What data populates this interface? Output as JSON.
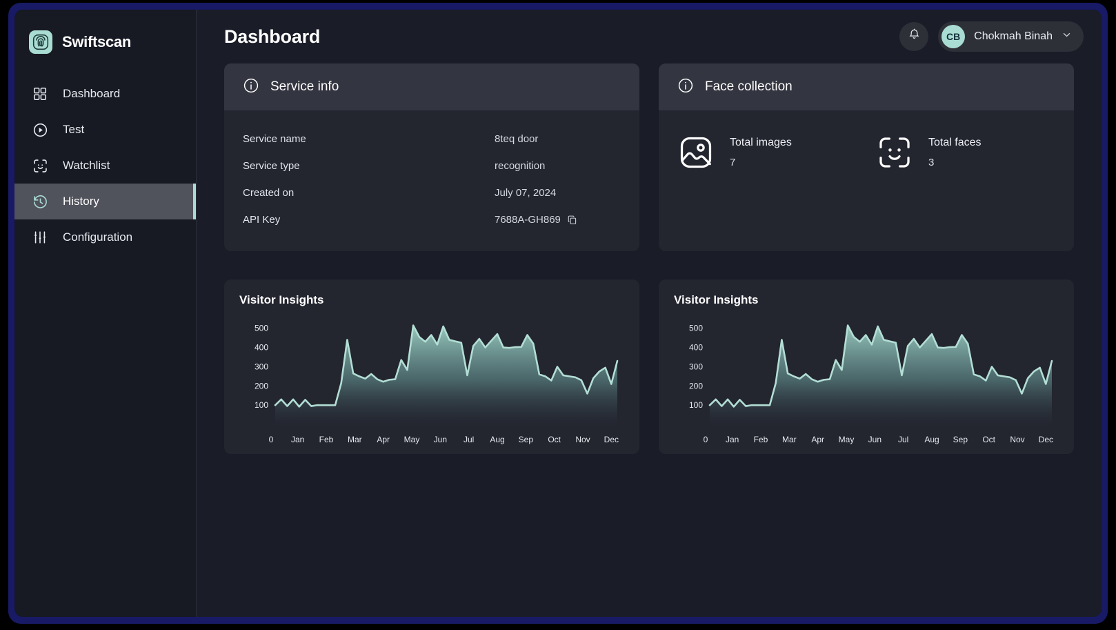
{
  "app": {
    "brand_name": "Swiftscan",
    "brand_icon": "fingerprint-icon",
    "accent": "#a9dcd2",
    "bezel_color": "#181a66",
    "surface": "#23252f",
    "background": "#1a1c28"
  },
  "sidebar": {
    "items": [
      {
        "label": "Dashboard",
        "icon": "grid-icon",
        "active": false
      },
      {
        "label": "Test",
        "icon": "play-circle-icon",
        "active": false
      },
      {
        "label": "Watchlist",
        "icon": "face-scan-icon",
        "active": false
      },
      {
        "label": "History",
        "icon": "clock-rotate-icon",
        "active": true
      },
      {
        "label": "Configuration",
        "icon": "sliders-icon",
        "active": false
      }
    ]
  },
  "header": {
    "title": "Dashboard",
    "notification_icon": "bell-icon",
    "user": {
      "initials": "CB",
      "name": "Chokmah Binah",
      "chevron_icon": "chevron-down-icon"
    }
  },
  "service_info": {
    "icon": "info-circle-icon",
    "title": "Service info",
    "rows": [
      {
        "key": "Service name",
        "value": "8teq door",
        "copyable": false
      },
      {
        "key": "Service type",
        "value": "recognition",
        "copyable": false
      },
      {
        "key": "Created on",
        "value": "July 07, 2024",
        "copyable": false
      },
      {
        "key": "API Key",
        "value": "7688A-GH869",
        "copyable": true,
        "copy_icon": "copy-icon"
      }
    ]
  },
  "face_collection": {
    "icon": "info-circle-icon",
    "title": "Face collection",
    "stats": [
      {
        "icon": "image-icon",
        "label": "Total images",
        "value": "7"
      },
      {
        "icon": "face-scan-icon",
        "label": "Total faces",
        "value": "3"
      }
    ]
  },
  "charts": [
    {
      "title": "Visitor Insights"
    },
    {
      "title": "Visitor Insights"
    }
  ],
  "chart_data": [
    {
      "type": "area",
      "title": "Visitor Insights",
      "xlabel": "",
      "ylabel": "",
      "origin_label": "0",
      "ylim": [
        0,
        560
      ],
      "yticks": [
        100,
        200,
        300,
        400,
        500
      ],
      "grid": false,
      "legend": "none",
      "line_color": "#b3ded5",
      "fill_top": "#9ed1c6",
      "fill_bottom": "#23252f",
      "categories": [
        "Jan",
        "Feb",
        "Mar",
        "Apr",
        "May",
        "Jun",
        "Jul",
        "Aug",
        "Sep",
        "Oct",
        "Nov",
        "Dec"
      ],
      "x": [
        0,
        1,
        2,
        3,
        4,
        5,
        6,
        7,
        8,
        9,
        10,
        11,
        12,
        13,
        14,
        15,
        16,
        17,
        18,
        19,
        20,
        21,
        22,
        23,
        24,
        25,
        26,
        27,
        28,
        29,
        30,
        31,
        32,
        33,
        34,
        35,
        36,
        37,
        38,
        39,
        40,
        41,
        42,
        43,
        44,
        45,
        46,
        47
      ],
      "values": [
        100,
        130,
        95,
        130,
        92,
        128,
        95,
        100,
        100,
        100,
        100,
        215,
        440,
        265,
        250,
        238,
        262,
        235,
        222,
        232,
        235,
        335,
        283,
        515,
        455,
        430,
        465,
        415,
        510,
        440,
        432,
        425,
        255,
        408,
        445,
        400,
        435,
        470,
        400,
        398,
        402,
        403,
        465,
        420,
        260,
        250,
        228,
        300,
        255,
        250,
        245,
        230,
        160,
        240,
        275,
        295,
        210,
        330
      ]
    },
    {
      "type": "area",
      "title": "Visitor Insights",
      "xlabel": "",
      "ylabel": "",
      "origin_label": "0",
      "ylim": [
        0,
        560
      ],
      "yticks": [
        100,
        200,
        300,
        400,
        500
      ],
      "grid": false,
      "legend": "none",
      "line_color": "#b3ded5",
      "fill_top": "#9ed1c6",
      "fill_bottom": "#23252f",
      "categories": [
        "Jan",
        "Feb",
        "Mar",
        "Apr",
        "May",
        "Jun",
        "Jul",
        "Aug",
        "Sep",
        "Oct",
        "Nov",
        "Dec"
      ],
      "x": [
        0,
        1,
        2,
        3,
        4,
        5,
        6,
        7,
        8,
        9,
        10,
        11,
        12,
        13,
        14,
        15,
        16,
        17,
        18,
        19,
        20,
        21,
        22,
        23,
        24,
        25,
        26,
        27,
        28,
        29,
        30,
        31,
        32,
        33,
        34,
        35,
        36,
        37,
        38,
        39,
        40,
        41,
        42,
        43,
        44,
        45,
        46,
        47
      ],
      "values": [
        100,
        130,
        95,
        130,
        92,
        128,
        95,
        100,
        100,
        100,
        100,
        215,
        440,
        265,
        250,
        238,
        262,
        235,
        222,
        232,
        235,
        335,
        283,
        515,
        455,
        430,
        465,
        415,
        510,
        440,
        432,
        425,
        255,
        408,
        445,
        400,
        435,
        470,
        400,
        398,
        402,
        403,
        465,
        420,
        260,
        250,
        228,
        300,
        255,
        250,
        245,
        230,
        160,
        240,
        275,
        295,
        210,
        330
      ]
    }
  ]
}
